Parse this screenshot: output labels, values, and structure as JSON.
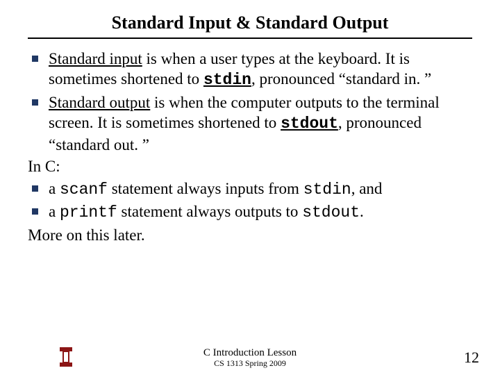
{
  "title": "Standard Input & Standard Output",
  "bullets": {
    "b1": {
      "term": "Standard input",
      "text1": " is when a user types at the keyboard. It is sometimes shortened to ",
      "code": "stdin",
      "text2": ", pronounced “standard in. ”"
    },
    "b2": {
      "term": "Standard output",
      "text1": " is when the computer outputs to the terminal screen. It is sometimes shortened to ",
      "code": "stdout",
      "text2": ", pronounced “standard out. ”"
    }
  },
  "inc": "In C:",
  "bullets2": {
    "b3": {
      "pre": "a ",
      "code": "scanf",
      "mid": " statement always inputs from ",
      "code2": "stdin",
      "post": ", and"
    },
    "b4": {
      "pre": "a ",
      "code": "printf",
      "mid": " statement always outputs to ",
      "code2": "stdout",
      "post": "."
    }
  },
  "more": "More on this later.",
  "footer": {
    "lesson": "C Introduction Lesson",
    "course": "CS 1313 Spring 2009"
  },
  "page": "12"
}
